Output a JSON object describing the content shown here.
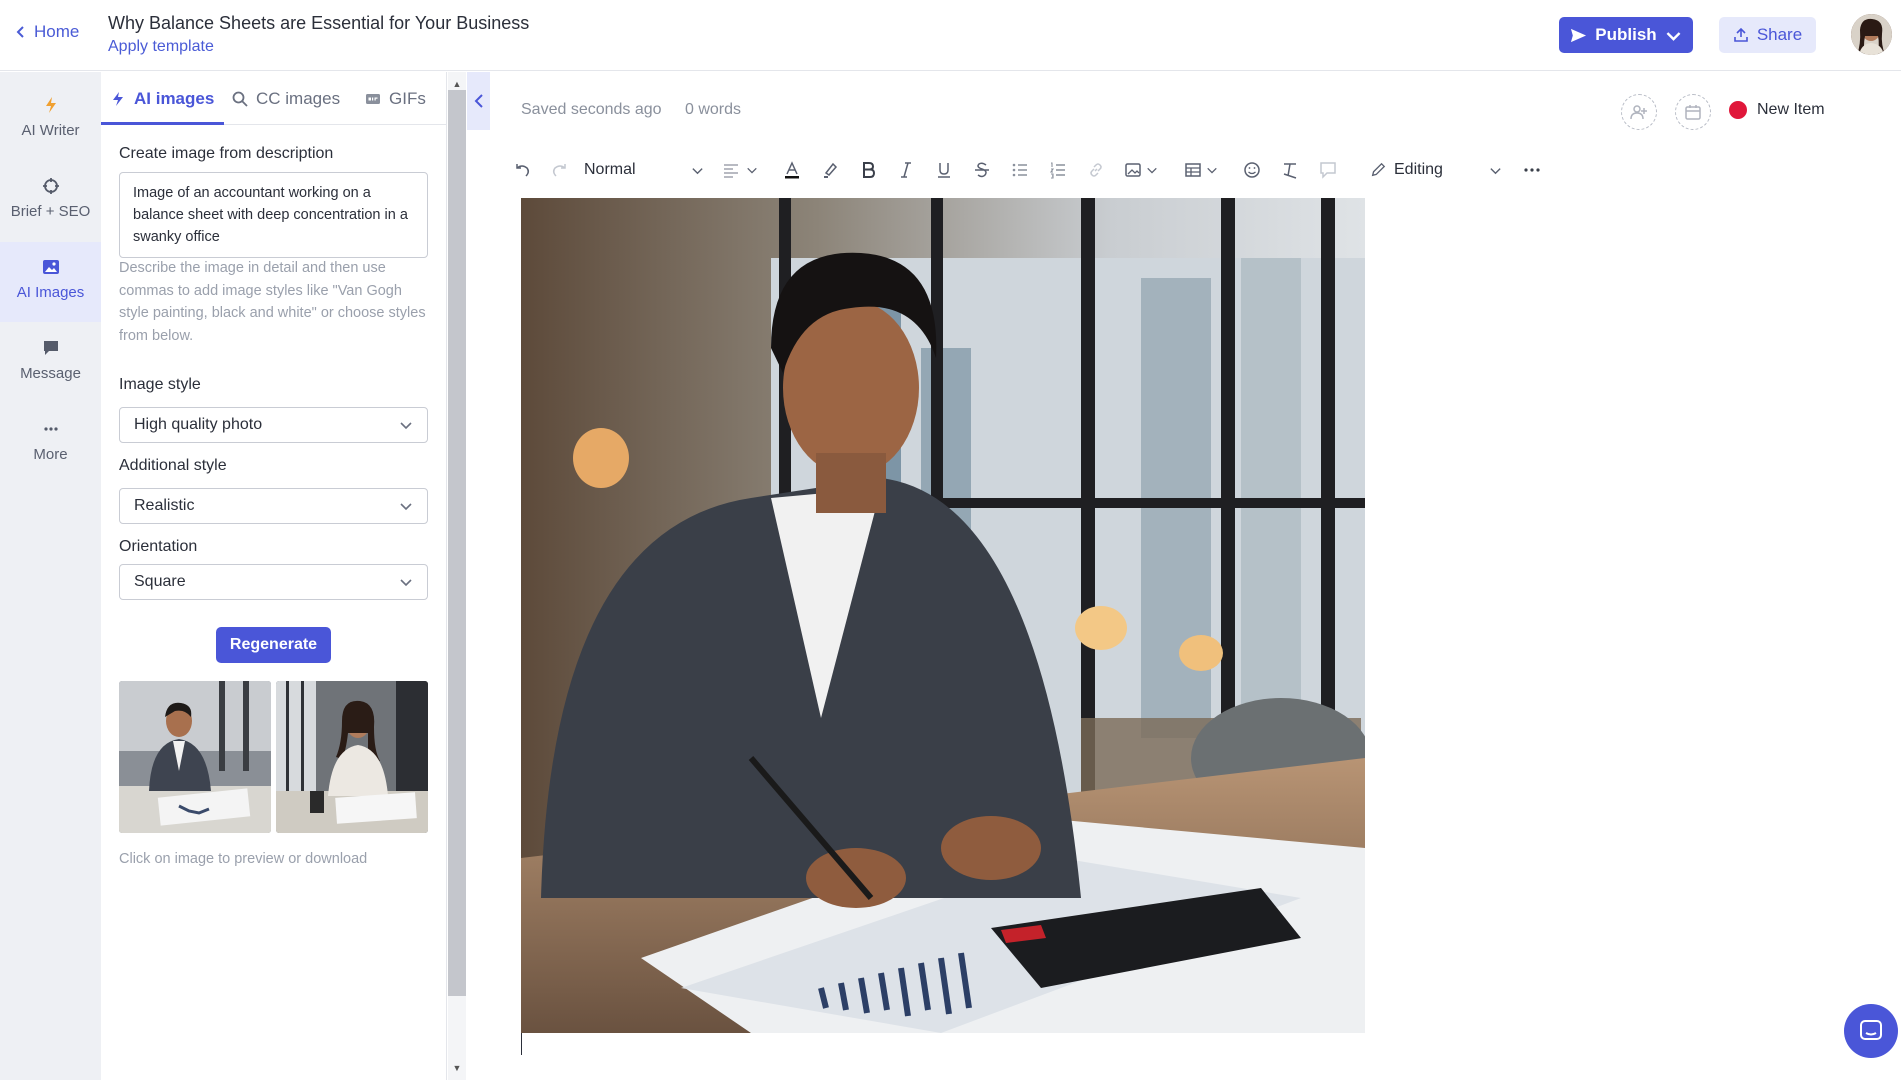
{
  "header": {
    "home_label": "Home",
    "doc_title": "Why Balance Sheets are Essential for Your Business",
    "apply_template": "Apply template",
    "publish_label": "Publish",
    "share_label": "Share",
    "accent_color": "#4a56d8"
  },
  "rail": {
    "items": [
      {
        "label": "AI Writer",
        "icon": "bolt-icon"
      },
      {
        "label": "Brief + SEO",
        "icon": "crosshair-icon"
      },
      {
        "label": "AI Images",
        "icon": "image-icon",
        "active": true
      },
      {
        "label": "Message",
        "icon": "chat-icon"
      },
      {
        "label": "More",
        "icon": "ellipsis-icon"
      }
    ]
  },
  "panel": {
    "tabs": [
      {
        "label": "AI images",
        "icon": "bolt-icon",
        "active": true
      },
      {
        "label": "CC images",
        "icon": "search-icon"
      },
      {
        "label": "GIFs",
        "icon": "gif-icon"
      }
    ],
    "create_label": "Create image from description",
    "description": "Image of an accountant working on a balance sheet with deep concentration in a swanky office",
    "help_text": "Describe the image in detail and then use commas to add image styles like \"Van Gogh style painting, black and white\" or choose styles from below.",
    "image_style_label": "Image style",
    "image_style_value": "High quality photo",
    "additional_style_label": "Additional style",
    "additional_style_value": "Realistic",
    "orientation_label": "Orientation",
    "orientation_value": "Square",
    "regenerate_label": "Regenerate",
    "thumb_hint": "Click on image to preview or download"
  },
  "editor": {
    "saved_status": "Saved seconds ago",
    "word_count": "0 words",
    "new_item_label": "New Item",
    "new_item_color": "#e0173a",
    "paragraph_style": "Normal",
    "mode_label": "Editing"
  }
}
